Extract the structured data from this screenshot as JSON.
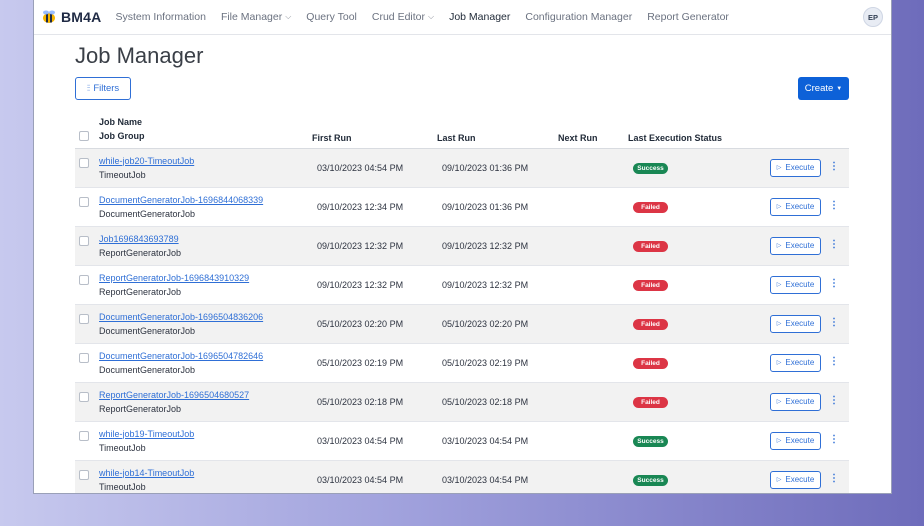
{
  "app": {
    "brand": "BM4A",
    "nav": [
      {
        "label": "System Information",
        "dropdown": false,
        "active": false
      },
      {
        "label": "File Manager",
        "dropdown": true,
        "active": false
      },
      {
        "label": "Query Tool",
        "dropdown": false,
        "active": false
      },
      {
        "label": "Crud Editor",
        "dropdown": true,
        "active": false
      },
      {
        "label": "Job Manager",
        "dropdown": false,
        "active": true
      },
      {
        "label": "Configuration Manager",
        "dropdown": false,
        "active": false
      },
      {
        "label": "Report Generator",
        "dropdown": false,
        "active": false
      }
    ],
    "user_initials": "EP"
  },
  "page": {
    "title": "Job Manager",
    "filters_label": "Filters",
    "create_label": "Create"
  },
  "table": {
    "headers": {
      "job_name": "Job Name",
      "job_group": "Job Group",
      "first_run": "First Run",
      "last_run": "Last Run",
      "next_run": "Next Run",
      "status": "Last Execution Status"
    },
    "execute_label": "Execute",
    "rows": [
      {
        "name": "while-job20-TimeoutJob",
        "group": "TimeoutJob",
        "first_run": "03/10/2023 04:54 PM",
        "last_run": "09/10/2023 01:36 PM",
        "next_run": "",
        "status": "Success"
      },
      {
        "name": "DocumentGeneratorJob-1696844068339",
        "group": "DocumentGeneratorJob",
        "first_run": "09/10/2023 12:34 PM",
        "last_run": "09/10/2023 01:36 PM",
        "next_run": "",
        "status": "Failed"
      },
      {
        "name": "Job1696843693789",
        "group": "ReportGeneratorJob",
        "first_run": "09/10/2023 12:32 PM",
        "last_run": "09/10/2023 12:32 PM",
        "next_run": "",
        "status": "Failed"
      },
      {
        "name": "ReportGeneratorJob-1696843910329",
        "group": "ReportGeneratorJob",
        "first_run": "09/10/2023 12:32 PM",
        "last_run": "09/10/2023 12:32 PM",
        "next_run": "",
        "status": "Failed"
      },
      {
        "name": "DocumentGeneratorJob-1696504836206",
        "group": "DocumentGeneratorJob",
        "first_run": "05/10/2023 02:20 PM",
        "last_run": "05/10/2023 02:20 PM",
        "next_run": "",
        "status": "Failed"
      },
      {
        "name": "DocumentGeneratorJob-1696504782646",
        "group": "DocumentGeneratorJob",
        "first_run": "05/10/2023 02:19 PM",
        "last_run": "05/10/2023 02:19 PM",
        "next_run": "",
        "status": "Failed"
      },
      {
        "name": "ReportGeneratorJob-1696504680527",
        "group": "ReportGeneratorJob",
        "first_run": "05/10/2023 02:18 PM",
        "last_run": "05/10/2023 02:18 PM",
        "next_run": "",
        "status": "Failed"
      },
      {
        "name": "while-job19-TimeoutJob",
        "group": "TimeoutJob",
        "first_run": "03/10/2023 04:54 PM",
        "last_run": "03/10/2023 04:54 PM",
        "next_run": "",
        "status": "Success"
      },
      {
        "name": "while-job14-TimeoutJob",
        "group": "TimeoutJob",
        "first_run": "03/10/2023 04:54 PM",
        "last_run": "03/10/2023 04:54 PM",
        "next_run": "",
        "status": "Success"
      }
    ]
  },
  "colors": {
    "primary": "#0d61d8",
    "link": "#2f6fd6",
    "success": "#198754",
    "danger": "#dc3545"
  }
}
